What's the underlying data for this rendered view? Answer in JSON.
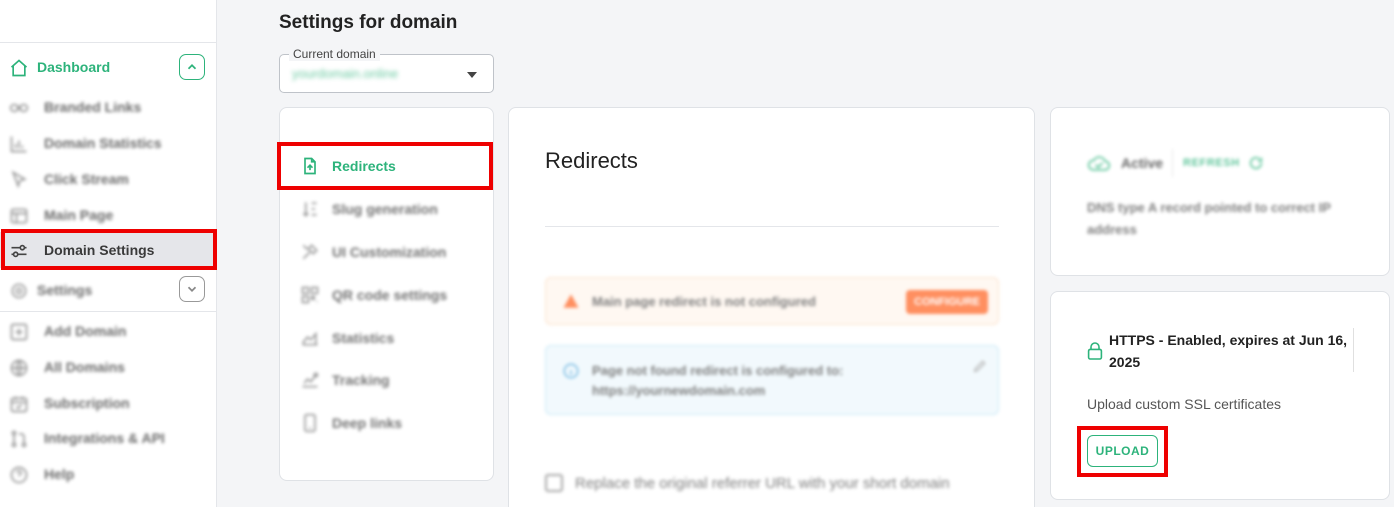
{
  "header": {
    "title": "Settings for domain",
    "domain_select": {
      "label": "Current domain",
      "value": "yourdomain.online"
    }
  },
  "sidebar": {
    "dashboard": "Dashboard",
    "items": [
      {
        "label": "Branded Links",
        "icon": "link-icon"
      },
      {
        "label": "Domain Statistics",
        "icon": "bar-chart-icon"
      },
      {
        "label": "Click Stream",
        "icon": "cursor-icon"
      },
      {
        "label": "Main Page",
        "icon": "layout-icon"
      },
      {
        "label": "Domain Settings",
        "icon": "sliders-icon"
      }
    ],
    "settings": "Settings",
    "items2": [
      {
        "label": "Add Domain",
        "icon": "plus-square-icon"
      },
      {
        "label": "All Domains",
        "icon": "globe-icon"
      },
      {
        "label": "Subscription",
        "icon": "calendar-icon"
      },
      {
        "label": "Integrations & API",
        "icon": "git-pull-icon"
      },
      {
        "label": "Help",
        "icon": "help-circle-icon"
      }
    ]
  },
  "settings_menu": [
    {
      "label": "Redirects",
      "icon": "file-upload-icon"
    },
    {
      "label": "Slug generation",
      "icon": "sort-icon"
    },
    {
      "label": "UI Customization",
      "icon": "tools-icon"
    },
    {
      "label": "QR code settings",
      "icon": "qr-code-icon"
    },
    {
      "label": "Statistics",
      "icon": "area-chart-icon"
    },
    {
      "label": "Tracking",
      "icon": "tracking-icon"
    },
    {
      "label": "Deep links",
      "icon": "smartphone-icon"
    }
  ],
  "redirects": {
    "title": "Redirects",
    "warning_text": "Main page redirect is not configured",
    "configure_label": "CONFIGURE",
    "info_text": "Page not found redirect is configured to: https://yournewdomain.com",
    "referrer_label": "Replace the original referrer URL with your short domain"
  },
  "dns_card": {
    "status": "Active",
    "refresh_label": "REFRESH",
    "description": "DNS type A record pointed to correct IP address"
  },
  "ssl_card": {
    "https_status": "HTTPS - Enabled, expires at Jun 16, 2025",
    "upload_label": "Upload custom SSL certificates",
    "upload_button": "UPLOAD"
  },
  "colors": {
    "accent": "#2db37b",
    "warning": "#ff6a2b",
    "highlight": "#ee0000"
  }
}
